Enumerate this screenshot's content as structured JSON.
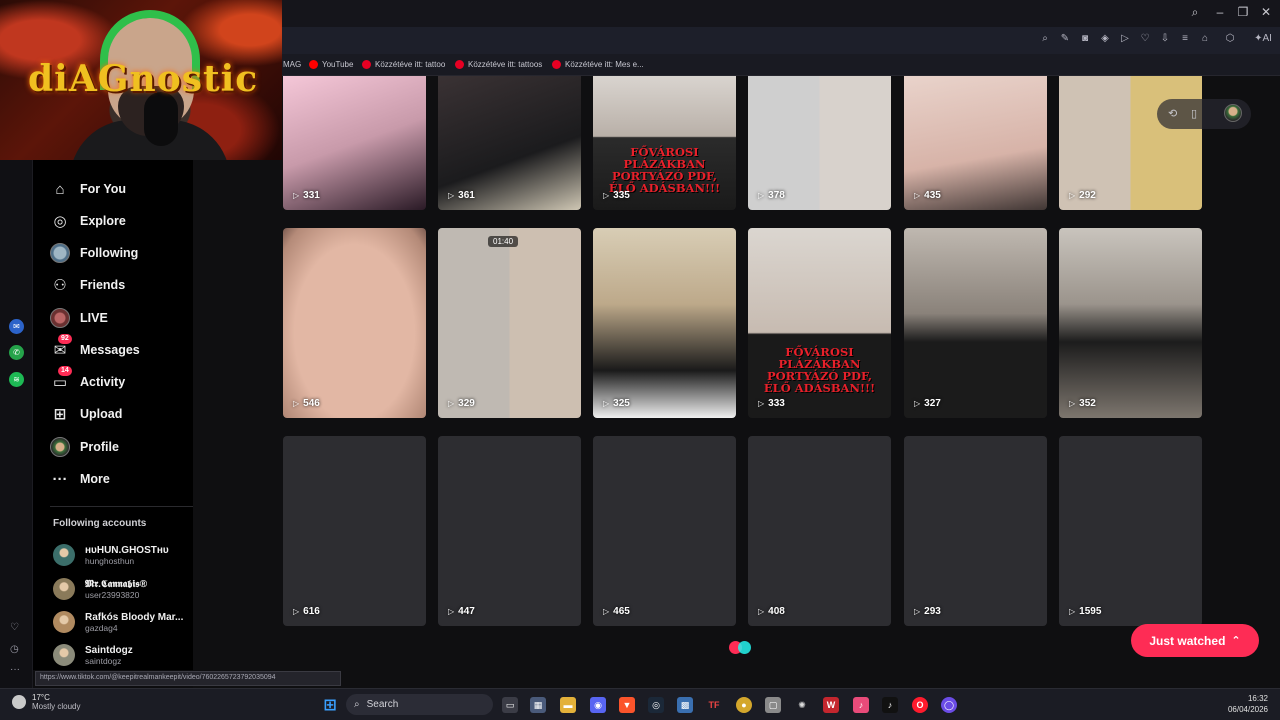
{
  "browser": {
    "bookmarks": [
      {
        "label": "MAG",
        "color": "#1d1f2a"
      },
      {
        "label": "YouTube",
        "color": "#ff0000"
      },
      {
        "label": "Közzétéve itt: tattoo",
        "color": "#e60023"
      },
      {
        "label": "Közzétéve itt: tattoos",
        "color": "#e60023"
      },
      {
        "label": "Közzétéve itt: Mes e...",
        "color": "#e60023"
      }
    ],
    "ai_label": "AI",
    "status_url": "https://www.tiktok.com/@keepitrealmankeepit/video/7602265723792035094"
  },
  "webcam": {
    "overlay_text": "diAGnostic"
  },
  "sidebar": {
    "nav": [
      {
        "label": "For You",
        "icon": "home-icon",
        "glyph": "⌂"
      },
      {
        "label": "Explore",
        "icon": "compass-icon",
        "glyph": "◎"
      },
      {
        "label": "Following",
        "icon": "avatar-icon",
        "glyph": ""
      },
      {
        "label": "Friends",
        "icon": "friends-icon",
        "glyph": "⚇"
      },
      {
        "label": "LIVE",
        "icon": "live-avatar-icon",
        "glyph": ""
      },
      {
        "label": "Messages",
        "icon": "messages-icon",
        "glyph": "✉",
        "badge": "92"
      },
      {
        "label": "Activity",
        "icon": "activity-icon",
        "glyph": "▭",
        "badge": "14"
      },
      {
        "label": "Upload",
        "icon": "upload-icon",
        "glyph": "⊞"
      },
      {
        "label": "Profile",
        "icon": "profile-avatar-icon",
        "glyph": ""
      },
      {
        "label": "More",
        "icon": "more-icon",
        "glyph": "···"
      }
    ],
    "following_title": "Following accounts",
    "accounts": [
      {
        "name": "ʜᴜHUN.GHOSTʜᴜ",
        "handle": "hunghosthun",
        "color": "#3b6e6a"
      },
      {
        "name": "𝕸𝖗.𝕮𝖆𝖓𝖓𝖆𝖇𝖎𝖘®",
        "handle": "user23993820",
        "color": "#8a7a5a"
      },
      {
        "name": "Rafkós Bloody Mar...",
        "handle": "gazdag4",
        "color": "#b08a60"
      },
      {
        "name": "Saintdogz",
        "handle": "saintdogz",
        "color": "#8b8b7a"
      }
    ]
  },
  "grid": {
    "rows": [
      [
        {
          "count": "331",
          "bg": "linear-gradient(160deg,#f5c7d8,#c89aaa 50%,#2a1a26)"
        },
        {
          "count": "361",
          "bg": "linear-gradient(160deg,#3a3234,#1b1b1d 60%,#cfc7b4)"
        },
        {
          "count": "335",
          "bg": "linear-gradient(180deg,#d9d4cf,#b9b0a8 45%,#2b2b2b 46%,#1a1a1a)",
          "overlay": "FŐVÁROSI PLÁZÁKBAN PORTYÁZÓ PDF, ÉLŐ ADÁSBAN!!!"
        },
        {
          "count": "378",
          "bg": "linear-gradient(90deg,#cfcfcf 0 50%,#d8d2cc 50%)"
        },
        {
          "count": "435",
          "bg": "linear-gradient(170deg,#e9d3cb,#d7b3a8 60%,#403634)"
        },
        {
          "count": "292",
          "bg": "linear-gradient(90deg,#cfc2b4 0 50%,#d9c07a 50%)"
        }
      ],
      [
        {
          "count": "546",
          "bg": "radial-gradient(ellipse at 50% 55%,#e2b7a4 0 60px,#b48a78 90px,#7a5a50)"
        },
        {
          "count": "329",
          "bg": "linear-gradient(90deg,#bfb9b2 0 50%,#cdbfb1 50%)",
          "duration": "01:40"
        },
        {
          "count": "325",
          "bg": "linear-gradient(180deg,#d8cdb5,#bda98a 40%,#1a1a1a 75%,#f0f0f0)"
        },
        {
          "count": "333",
          "bg": "linear-gradient(180deg,#dbd6d0,#c7bbb1 55%,#1a1a1a 56%)",
          "overlay": "FŐVÁROSI PLÁZÁKBAN PORTYÁZÓ PDF, ÉLŐ ADÁSBAN!!!"
        },
        {
          "count": "327",
          "bg": "linear-gradient(180deg,#bfb8b0,#8a827a 45%,#1b1b1b 60%)"
        },
        {
          "count": "352",
          "bg": "linear-gradient(180deg,#c9c4bd,#9b948c 40%,#1c1c1c 60%,#7d766e)"
        }
      ],
      [
        {
          "count": "616",
          "bg": "#2d2d31"
        },
        {
          "count": "447",
          "bg": "#2d2d31"
        },
        {
          "count": "465",
          "bg": "#2d2d31"
        },
        {
          "count": "408",
          "bg": "#2d2d31"
        },
        {
          "count": "293",
          "bg": "#2d2d31"
        },
        {
          "count": "1595",
          "bg": "#2d2d31"
        }
      ]
    ]
  },
  "just_watched": {
    "label": "Just watched",
    "icon": "double-chevron-up-icon"
  },
  "taskbar": {
    "weather_temp": "17°C",
    "weather_desc": "Mostly cloudy",
    "search_placeholder": "Search",
    "time": "16:32",
    "date": "06/04/2026"
  },
  "colors": {
    "accent": "#fe2c55",
    "secondary": "#25f4ee"
  }
}
